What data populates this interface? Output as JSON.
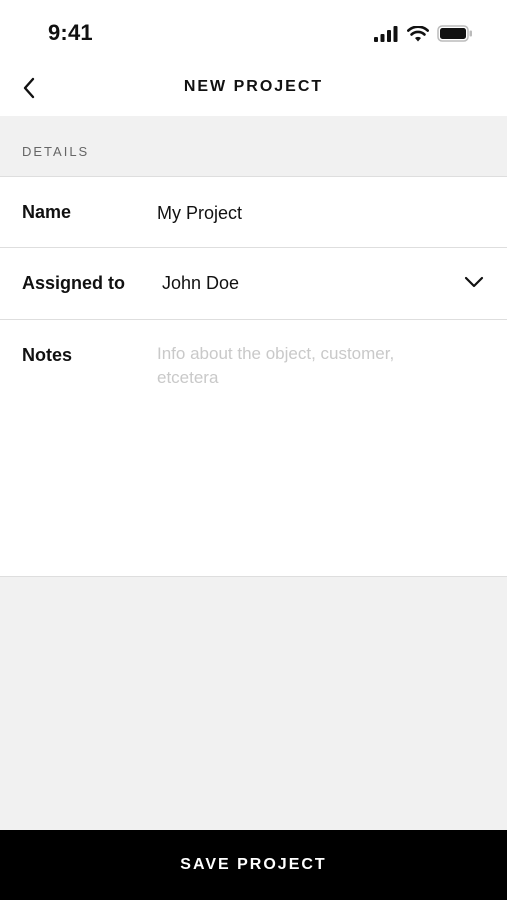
{
  "status_bar": {
    "time": "9:41",
    "icons": [
      "cellular-signal-icon",
      "wifi-icon",
      "battery-icon"
    ]
  },
  "nav": {
    "title": "NEW PROJECT",
    "back_icon": "chevron-left-icon"
  },
  "section": {
    "title": "DETAILS"
  },
  "form": {
    "name": {
      "label": "Name",
      "value": "My Project"
    },
    "assigned_to": {
      "label": "Assigned to",
      "value": "John Doe",
      "icon": "chevron-down-icon"
    },
    "notes": {
      "label": "Notes",
      "value": "",
      "placeholder": "Info about the object, customer, etcetera"
    }
  },
  "save_button": {
    "label": "SAVE PROJECT"
  },
  "colors": {
    "background": "#f1f1f1",
    "surface": "#ffffff",
    "text": "#111111",
    "muted": "#666666",
    "placeholder": "#c9c9c9",
    "button": "#000000"
  }
}
